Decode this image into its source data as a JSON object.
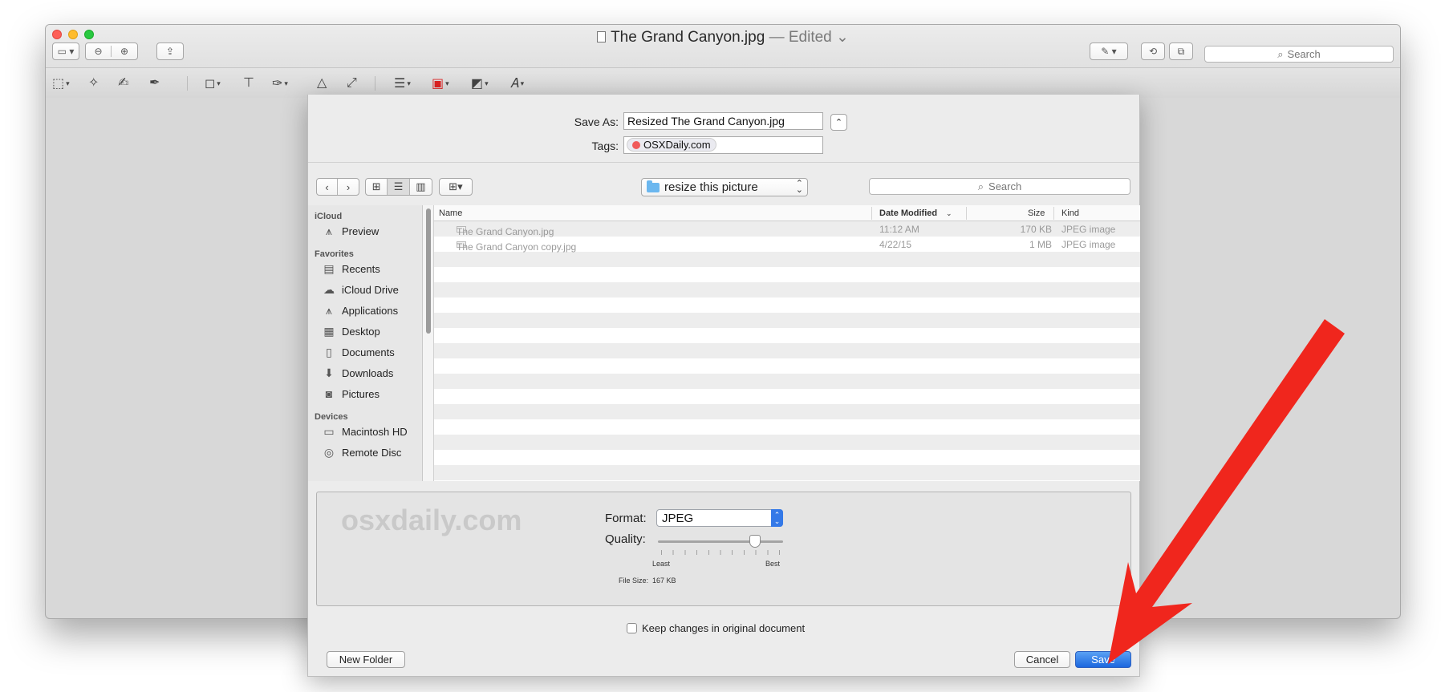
{
  "window": {
    "title": "The Grand Canyon.jpg",
    "title_suffix": " — Edited",
    "search_placeholder": "Search"
  },
  "sheet": {
    "save_as_label": "Save As:",
    "save_as_value": "Resized The Grand Canyon.jpg",
    "tags_label": "Tags:",
    "tag_name": "OSXDaily.com",
    "tag_color": "#f05a5a",
    "location": "resize this picture",
    "search_placeholder": "Search",
    "sidebar": {
      "icloud_header": "iCloud",
      "icloud_items": [
        {
          "label": "Preview",
          "icon": "preview-app-icon"
        }
      ],
      "favorites_header": "Favorites",
      "favorites_items": [
        {
          "label": "Recents",
          "icon": "recents-icon"
        },
        {
          "label": "iCloud Drive",
          "icon": "cloud-icon"
        },
        {
          "label": "Applications",
          "icon": "applications-icon"
        },
        {
          "label": "Desktop",
          "icon": "desktop-icon"
        },
        {
          "label": "Documents",
          "icon": "documents-icon"
        },
        {
          "label": "Downloads",
          "icon": "downloads-icon"
        },
        {
          "label": "Pictures",
          "icon": "camera-icon"
        }
      ],
      "devices_header": "Devices",
      "devices_items": [
        {
          "label": "Macintosh HD",
          "icon": "hard-drive-icon"
        },
        {
          "label": "Remote Disc",
          "icon": "disc-icon"
        }
      ]
    },
    "columns": {
      "name": "Name",
      "date": "Date Modified",
      "size": "Size",
      "kind": "Kind"
    },
    "files": [
      {
        "name": "The Grand Canyon.jpg",
        "date": "11:12 AM",
        "size": "170 KB",
        "kind": "JPEG image"
      },
      {
        "name": "The Grand Canyon copy.jpg",
        "date": "4/22/15",
        "size": "1 MB",
        "kind": "JPEG image"
      }
    ],
    "watermark": "osxdaily.com",
    "format_label": "Format:",
    "format_value": "JPEG",
    "quality_label": "Quality:",
    "quality_level": 0.8,
    "least_label": "Least",
    "best_label": "Best",
    "file_size_label": "File Size:",
    "file_size_value": "167 KB",
    "keep_changes_label": "Keep changes in original document",
    "keep_changes_checked": false,
    "new_folder_label": "New Folder",
    "cancel_label": "Cancel",
    "save_label": "Save"
  },
  "colors": {
    "accent": "#1c67de",
    "annotation_arrow": "#f0261d"
  }
}
